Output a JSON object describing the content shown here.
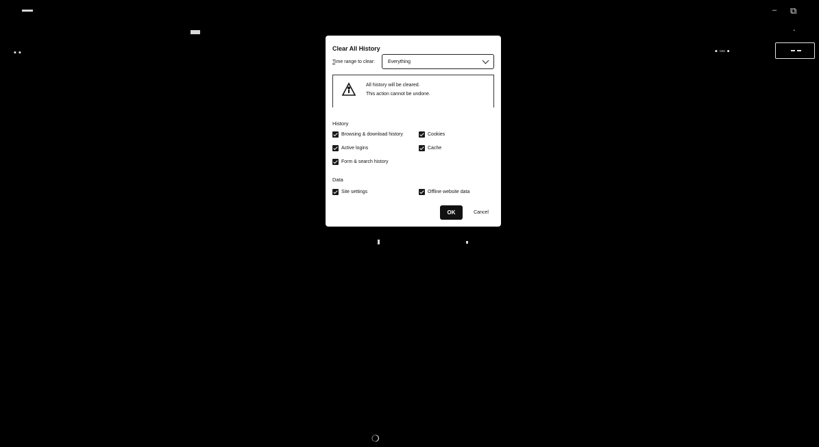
{
  "background_color": "#000000",
  "dialog": {
    "title": "Clear All History",
    "range_label": "Time range to clear:",
    "range_value": "Everything",
    "warning_icon": "warning-person-icon",
    "warning_line1": "All history will be cleared.",
    "warning_line2": "This action cannot be undone.",
    "history_section": "History",
    "history_items": [
      {
        "label": "Browsing & download history",
        "checked": true
      },
      {
        "label": "Cookies",
        "checked": true
      },
      {
        "label": "Active logins",
        "checked": true
      },
      {
        "label": "Cache",
        "checked": true
      },
      {
        "label": "Form & search history",
        "checked": true
      }
    ],
    "data_section": "Data",
    "data_items": [
      {
        "label": "Site settings",
        "checked": true
      },
      {
        "label": "Offline website data",
        "checked": true
      }
    ],
    "ok_label": "OK",
    "cancel_label": "Cancel"
  }
}
